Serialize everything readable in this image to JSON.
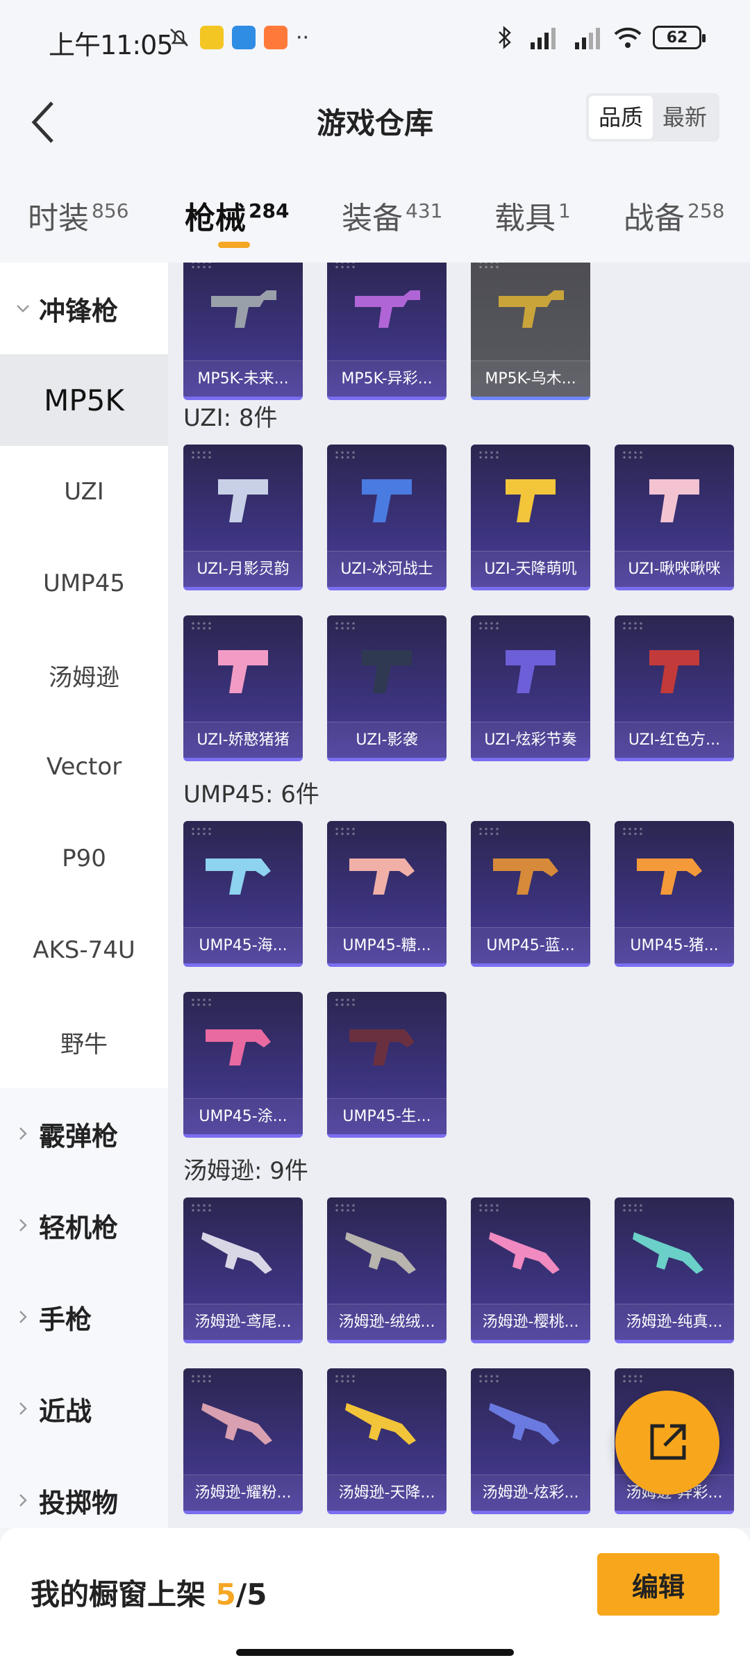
{
  "status": {
    "time": "上午11:05",
    "battery": "62"
  },
  "header": {
    "title": "游戏仓库",
    "sort_quality": "品质",
    "sort_latest": "最新"
  },
  "tabs": [
    {
      "label": "时装",
      "count": "856"
    },
    {
      "label": "枪械",
      "count": "284"
    },
    {
      "label": "装备",
      "count": "431"
    },
    {
      "label": "载具",
      "count": "1"
    },
    {
      "label": "战备",
      "count": "258"
    }
  ],
  "sidebar": {
    "groups": [
      {
        "label": "冲锋枪"
      },
      {
        "label": "霰弹枪"
      },
      {
        "label": "轻机枪"
      },
      {
        "label": "手枪"
      },
      {
        "label": "近战"
      },
      {
        "label": "投掷物"
      }
    ],
    "subs": [
      "MP5K",
      "UZI",
      "UMP45",
      "汤姆逊",
      "Vector",
      "P90",
      "AKS-74U",
      "野牛"
    ]
  },
  "content": {
    "mp5k_items": [
      "MP5K-未来...",
      "MP5K-异彩...",
      "MP5K-乌木..."
    ],
    "uzi_title": "UZI: 8件",
    "uzi_items": [
      "UZI-月影灵韵",
      "UZI-冰河战士",
      "UZI-天降萌叽",
      "UZI-啾咪啾咪",
      "UZI-娇憨猪猪",
      "UZI-影袭",
      "UZI-炫彩节奏",
      "UZI-红色方..."
    ],
    "ump_title": "UMP45: 6件",
    "ump_items": [
      "UMP45-海...",
      "UMP45-糖...",
      "UMP45-蓝...",
      "UMP45-猪...",
      "UMP45-涂...",
      "UMP45-生..."
    ],
    "thompson_title": "汤姆逊: 9件",
    "thompson_items": [
      "汤姆逊-鸢尾...",
      "汤姆逊-绒绒...",
      "汤姆逊-樱桃...",
      "汤姆逊-纯真...",
      "汤姆逊-耀粉...",
      "汤姆逊-天降...",
      "汤姆逊-炫彩...",
      "汤姆逊-异彩..."
    ]
  },
  "bottom": {
    "shelf_label": "我的橱窗上架",
    "shelf_current": "5",
    "shelf_total": "/5",
    "edit_label": "编辑"
  },
  "colors": {
    "accent": "#f8a71c",
    "card_bg": "#3d3480"
  }
}
